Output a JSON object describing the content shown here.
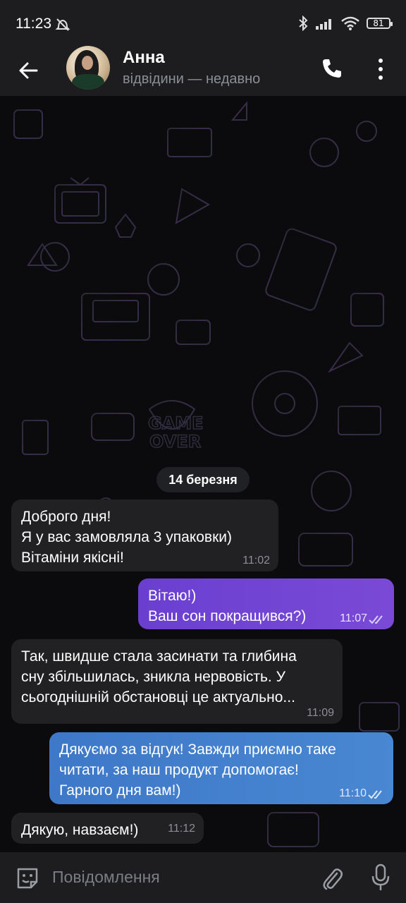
{
  "status_bar": {
    "time": "11:23",
    "battery": "81",
    "icons": [
      "dnd-icon",
      "bluetooth-icon",
      "signal-icon",
      "wifi-icon",
      "battery-icon"
    ]
  },
  "header": {
    "contact_name": "Анна",
    "contact_status": "відвідини — недавно",
    "icons": [
      "back-arrow-icon",
      "phone-icon",
      "more-vertical-icon"
    ]
  },
  "chat": {
    "date_label": "14 березня",
    "messages": [
      {
        "direction": "incoming",
        "text": "Доброго дня!\nЯ у вас замовляла 3 упаковки)\nВітаміни якісні!",
        "time": "11:02"
      },
      {
        "direction": "outgoing",
        "text": "Вітаю!)\nВаш сон покращився?)",
        "time": "11:07",
        "read": true
      },
      {
        "direction": "incoming",
        "text": "Так, швидше стала засинати та глибина\nсну збільшилась, зникла нервовість. У\nсьогоднішній обстановці це актуально...",
        "time": "11:09"
      },
      {
        "direction": "outgoing",
        "text": "Дякуємо за відгук! Завжди приємно таке\nчитати, за наш продукт допомогає!\nГарного дня вам!)",
        "time": "11:10",
        "read": true
      },
      {
        "direction": "incoming",
        "text": "Дякую, навзаєм!)",
        "time": "11:12"
      }
    ]
  },
  "composer": {
    "placeholder": "Повідомлення",
    "icons": [
      "emoji-icon",
      "attach-icon",
      "microphone-icon"
    ]
  },
  "colors": {
    "bar_bg": "#1d1d1f",
    "incoming_bubble": "#212124",
    "outgoing_purple": "#6a3fd0",
    "outgoing_blue": "#3e78c8"
  }
}
